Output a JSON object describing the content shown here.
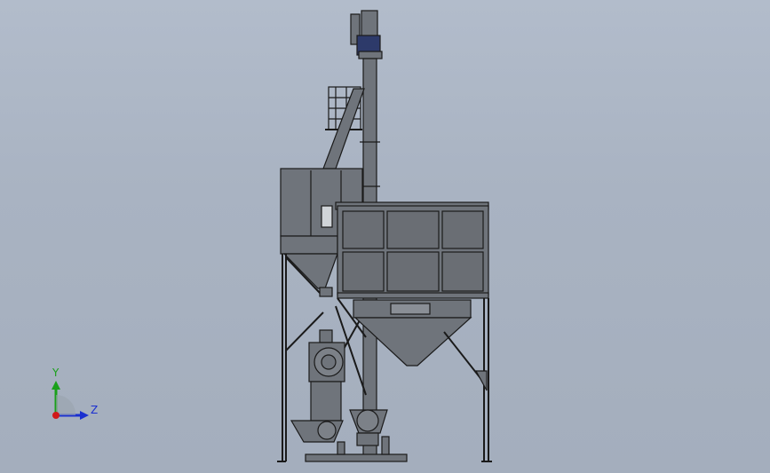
{
  "triad": {
    "y_label": "Y",
    "z_label": "Z",
    "y_color": "#1aa01a",
    "z_color": "#1a2fd0",
    "x_color": "#d01a1a"
  },
  "model": {
    "line_color": "#1a1a1a",
    "fill_color": "#7a7f86",
    "motor_color": "#2d3a6a"
  }
}
